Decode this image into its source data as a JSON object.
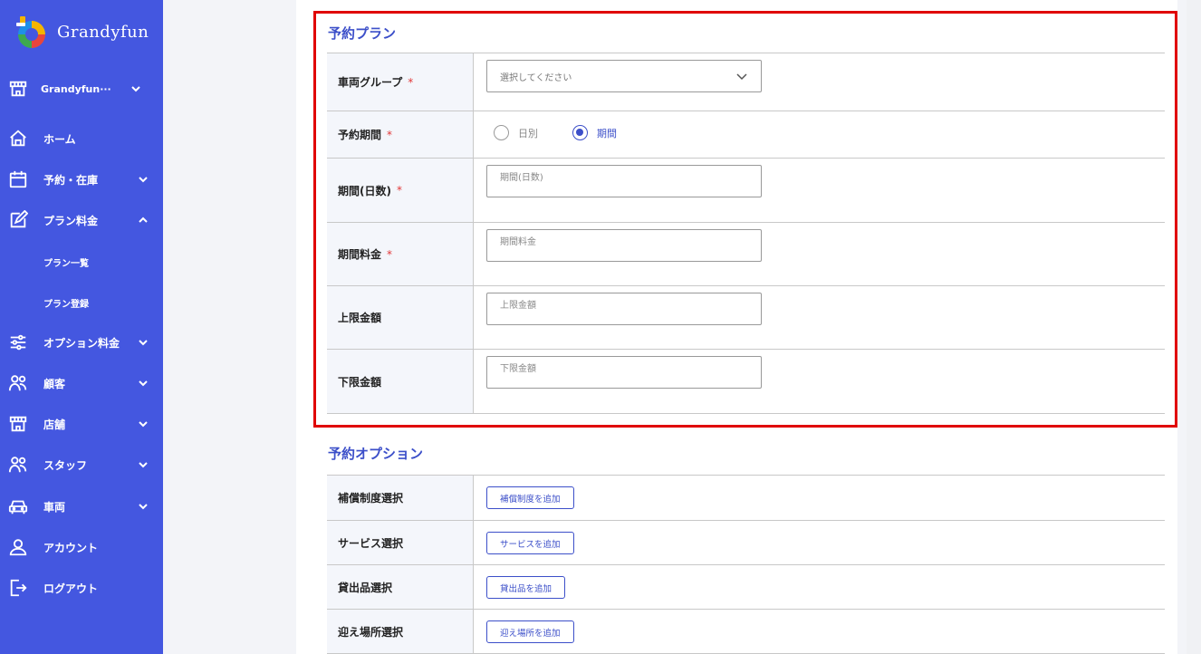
{
  "brand": {
    "name": "Grandyfun"
  },
  "sidebar": {
    "store_selector": "Grandyfun···",
    "items": [
      {
        "label": "ホーム",
        "icon": "home-icon"
      },
      {
        "label": "予約・在庫",
        "icon": "calendar-icon",
        "expanded": false
      },
      {
        "label": "プラン料金",
        "icon": "edit-icon",
        "expanded": true
      },
      {
        "label": "オプション料金",
        "icon": "sliders-icon",
        "expanded": false
      },
      {
        "label": "顧客",
        "icon": "users-icon",
        "expanded": false
      },
      {
        "label": "店舗",
        "icon": "store-icon",
        "expanded": false
      },
      {
        "label": "スタッフ",
        "icon": "users-icon",
        "expanded": false
      },
      {
        "label": "車両",
        "icon": "car-icon",
        "expanded": false
      },
      {
        "label": "アカウント",
        "icon": "user-icon"
      },
      {
        "label": "ログアウト",
        "icon": "logout-icon"
      }
    ],
    "plan_subitems": [
      "プラン一覧",
      "プラン登録"
    ]
  },
  "plan_section": {
    "title": "予約プラン",
    "vehicle_group": {
      "label": "車両グループ",
      "required_mark": "*",
      "placeholder": "選択してください"
    },
    "period_type": {
      "label": "予約期間",
      "required_mark": "*",
      "options": [
        "日別",
        "期間"
      ],
      "selected": "期間"
    },
    "period_days": {
      "label": "期間(日数)",
      "required_mark": "*",
      "placeholder": "期間(日数)"
    },
    "period_price": {
      "label": "期間料金",
      "required_mark": "*",
      "placeholder": "期間料金"
    },
    "max_amount": {
      "label": "上限金額",
      "placeholder": "上限金額"
    },
    "min_amount": {
      "label": "下限金額",
      "placeholder": "下限金額"
    }
  },
  "option_section": {
    "title": "予約オプション",
    "rows": [
      {
        "label": "補償制度選択",
        "button": "補償制度を追加"
      },
      {
        "label": "サービス選択",
        "button": "サービスを追加"
      },
      {
        "label": "貸出品選択",
        "button": "貸出品を追加"
      },
      {
        "label": "迎え場所選択",
        "button": "迎え場所を追加"
      }
    ]
  },
  "colors": {
    "sidebar": "#4457e0",
    "accent": "#3c4fc9",
    "required": "#e23838",
    "highlight": "#e00000"
  }
}
